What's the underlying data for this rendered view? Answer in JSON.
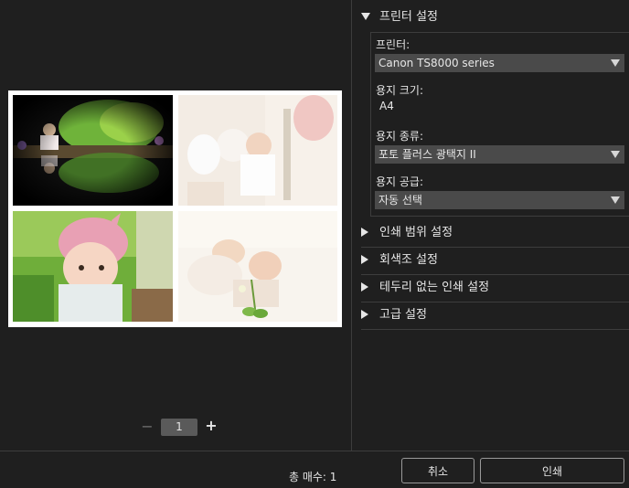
{
  "preview": {
    "page_number": "1",
    "minus_label": "−",
    "plus_label": "+"
  },
  "settings": {
    "printer_section": {
      "title": "프린터 설정",
      "printer_label": "프린터:",
      "printer_value": "Canon TS8000 series",
      "paper_size_label": "용지 크기:",
      "paper_size_value": "A4",
      "paper_type_label": "용지 종류:",
      "paper_type_value": "포토 플러스 광택지 II",
      "paper_source_label": "용지 공급:",
      "paper_source_value": "자동 선택"
    },
    "collapsed_sections": [
      "인쇄 범위 설정",
      "회색조 설정",
      "테두리 없는 인쇄 설정",
      "고급 설정"
    ]
  },
  "footer": {
    "total_sheets": "총 매수: 1",
    "cancel_label": "취소",
    "print_label": "인쇄"
  },
  "colors": {
    "background": "#1f1f1f",
    "select_bg": "#4a4a4a",
    "divider": "#3d3d3d"
  }
}
